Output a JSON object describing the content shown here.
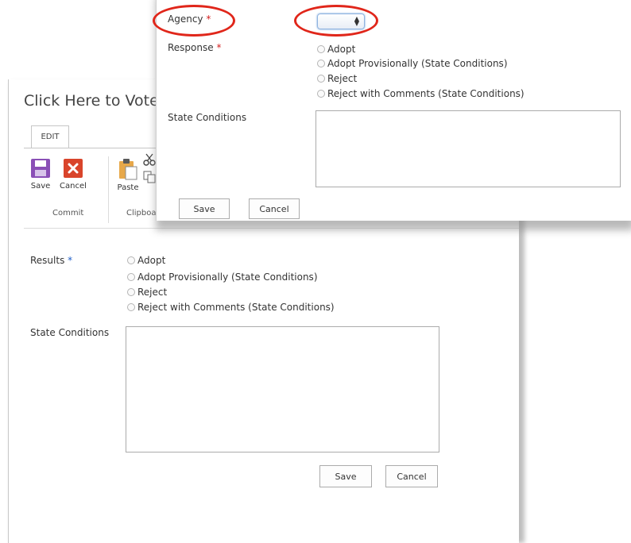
{
  "back": {
    "title": "Click Here to Vote",
    "tab_edit": "EDIT",
    "ribbon": {
      "save_label": "Save",
      "cancel_label": "Cancel",
      "paste_label": "Paste",
      "commit_group": "Commit",
      "clipboard_group": "Clipboard"
    },
    "results_label": "Results",
    "required_mark": "*",
    "options": [
      "Adopt",
      "Adopt Provisionally (State Conditions)",
      "Reject",
      "Reject with Comments (State Conditions)"
    ],
    "state_conditions_label": "State Conditions",
    "save_button": "Save",
    "cancel_button": "Cancel"
  },
  "front": {
    "agency_label": "Agency",
    "response_label": "Response",
    "required_mark": "*",
    "options": [
      "Adopt",
      "Adopt Provisionally (State Conditions)",
      "Reject",
      "Reject with Comments (State Conditions)"
    ],
    "state_conditions_label": "State Conditions",
    "save_button": "Save",
    "cancel_button": "Cancel",
    "agency_selected": ""
  },
  "colors": {
    "highlight": "#e0261a",
    "required_back": "#1e5ec8",
    "required_front": "#d42020",
    "save_icon": "#8a4fb6",
    "cancel_icon": "#d9442b"
  },
  "icons": [
    "save-icon",
    "cancel-icon",
    "paste-icon",
    "cut-icon",
    "copy-icon",
    "select-arrows-icon"
  ]
}
